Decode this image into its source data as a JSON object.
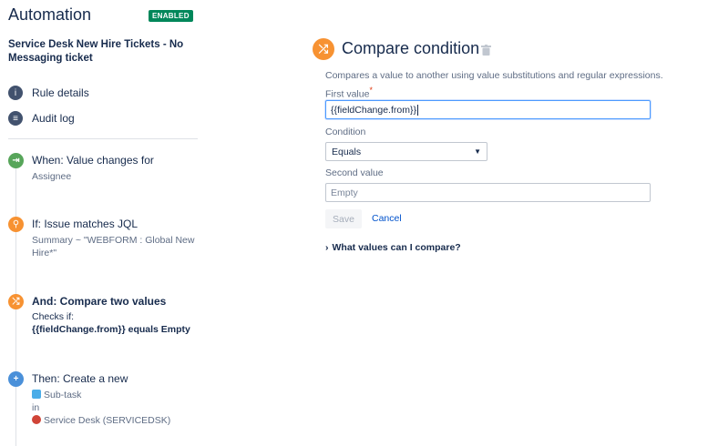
{
  "app": {
    "title": "Automation",
    "status_badge": "ENABLED"
  },
  "rule": {
    "name": "Service Desk New Hire Tickets - No Messaging ticket"
  },
  "nav": [
    {
      "label": "Rule details",
      "icon": "info-icon"
    },
    {
      "label": "Audit log",
      "icon": "list-icon"
    }
  ],
  "steps": {
    "trigger": {
      "title": "When: Value changes for",
      "detail": "Assignee",
      "color": "#57a55a"
    },
    "condition_jql": {
      "title": "If: Issue matches JQL",
      "detail": "Summary ~ \"WEBFORM : Global New Hire*\"",
      "color": "#f79232"
    },
    "condition_compare": {
      "title": "And: Compare two values",
      "detail_prefix": "Checks if:",
      "detail": "{{fieldChange.from}} equals Empty",
      "color": "#f79232"
    },
    "action": {
      "title": "Then: Create a new",
      "issue_type": "Sub-task",
      "in_label": "in",
      "project": "Service Desk (SERVICEDSK)",
      "color": "#4a90d9"
    }
  },
  "panel": {
    "title": "Compare condition",
    "description": "Compares a value to another using value substitutions and regular expressions.",
    "first_value_label": "First value",
    "required_mark": "*",
    "first_value": "{{fieldChange.from}}",
    "condition_label": "Condition",
    "condition_value": "Equals",
    "second_value_label": "Second value",
    "second_value_placeholder": "Empty",
    "save_label": "Save",
    "cancel_label": "Cancel",
    "help_toggle": "What values can I compare?"
  }
}
